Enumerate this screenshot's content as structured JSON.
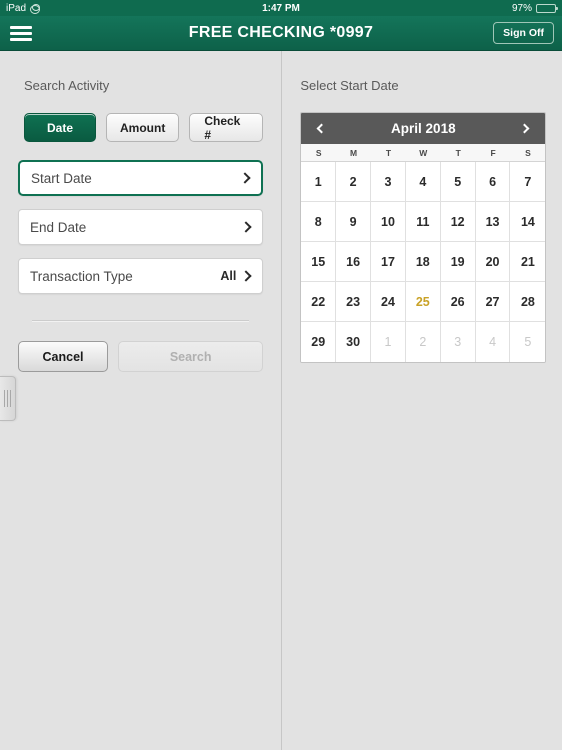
{
  "status_bar": {
    "device": "iPad",
    "rotation_lock_icon": "rotation-lock-icon",
    "time": "1:47 PM",
    "battery_percent": "97%",
    "battery_icon": "battery-icon",
    "battery_level": 97
  },
  "nav_bar": {
    "menu_icon": "hamburger-menu-icon",
    "title": "FREE CHECKING *0997",
    "sign_off_label": "Sign Off"
  },
  "left_panel": {
    "title": "Search Activity",
    "segmented": [
      {
        "label": "Date",
        "active": true
      },
      {
        "label": "Amount",
        "active": false
      },
      {
        "label": "Check #",
        "active": false
      }
    ],
    "fields": [
      {
        "label": "Start Date",
        "value": "",
        "focused": true
      },
      {
        "label": "End Date",
        "value": "",
        "focused": false
      },
      {
        "label": "Transaction Type",
        "value": "All",
        "focused": false
      }
    ],
    "cancel_label": "Cancel",
    "search_label": "Search",
    "search_disabled": true
  },
  "right_panel": {
    "title": "Select Start Date",
    "calendar": {
      "month_title": "April 2018",
      "prev_icon": "chevron-left-icon",
      "next_icon": "chevron-right-icon",
      "weekdays": [
        "S",
        "M",
        "T",
        "W",
        "T",
        "F",
        "S"
      ],
      "days": [
        {
          "d": "1",
          "muted": false,
          "today": false
        },
        {
          "d": "2",
          "muted": false,
          "today": false
        },
        {
          "d": "3",
          "muted": false,
          "today": false
        },
        {
          "d": "4",
          "muted": false,
          "today": false
        },
        {
          "d": "5",
          "muted": false,
          "today": false
        },
        {
          "d": "6",
          "muted": false,
          "today": false
        },
        {
          "d": "7",
          "muted": false,
          "today": false
        },
        {
          "d": "8",
          "muted": false,
          "today": false
        },
        {
          "d": "9",
          "muted": false,
          "today": false
        },
        {
          "d": "10",
          "muted": false,
          "today": false
        },
        {
          "d": "11",
          "muted": false,
          "today": false
        },
        {
          "d": "12",
          "muted": false,
          "today": false
        },
        {
          "d": "13",
          "muted": false,
          "today": false
        },
        {
          "d": "14",
          "muted": false,
          "today": false
        },
        {
          "d": "15",
          "muted": false,
          "today": false
        },
        {
          "d": "16",
          "muted": false,
          "today": false
        },
        {
          "d": "17",
          "muted": false,
          "today": false
        },
        {
          "d": "18",
          "muted": false,
          "today": false
        },
        {
          "d": "19",
          "muted": false,
          "today": false
        },
        {
          "d": "20",
          "muted": false,
          "today": false
        },
        {
          "d": "21",
          "muted": false,
          "today": false
        },
        {
          "d": "22",
          "muted": false,
          "today": false
        },
        {
          "d": "23",
          "muted": false,
          "today": false
        },
        {
          "d": "24",
          "muted": false,
          "today": false
        },
        {
          "d": "25",
          "muted": false,
          "today": true
        },
        {
          "d": "26",
          "muted": false,
          "today": false
        },
        {
          "d": "27",
          "muted": false,
          "today": false
        },
        {
          "d": "28",
          "muted": false,
          "today": false
        },
        {
          "d": "29",
          "muted": false,
          "today": false
        },
        {
          "d": "30",
          "muted": false,
          "today": false
        },
        {
          "d": "1",
          "muted": true,
          "today": false
        },
        {
          "d": "2",
          "muted": true,
          "today": false
        },
        {
          "d": "3",
          "muted": true,
          "today": false
        },
        {
          "d": "4",
          "muted": true,
          "today": false
        },
        {
          "d": "5",
          "muted": true,
          "today": false
        }
      ]
    }
  },
  "colors": {
    "brand_green": "#0f7152",
    "status_green": "#0f6b4f",
    "calendar_header_gray": "#595959",
    "today_gold": "#c9a227",
    "panel_bg": "#e2e2e2"
  }
}
